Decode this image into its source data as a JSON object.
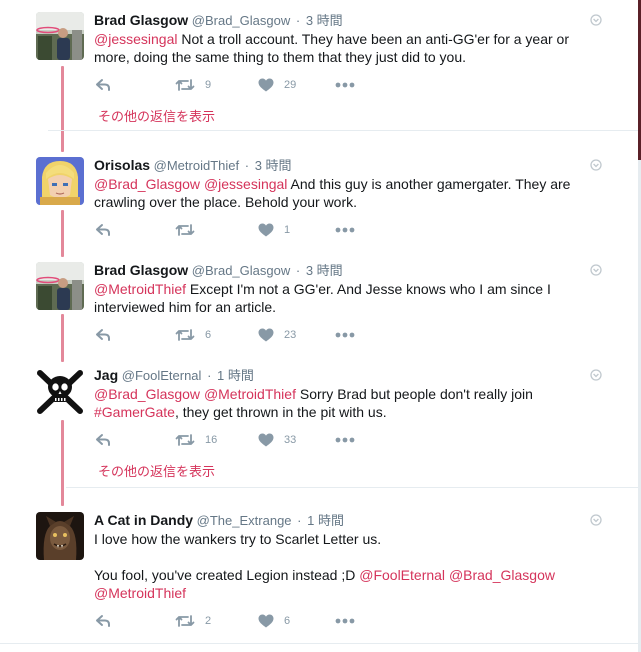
{
  "tweets": [
    {
      "name": "Brad Glasgow",
      "handle": "@Brad_Glasgow",
      "time": "3 時間",
      "body_line1": [
        {
          "t": "@jessesingal",
          "link": true
        },
        {
          "t": " Not a troll account. They have been an anti-GG'er for a year or",
          "link": false
        }
      ],
      "body_line2": [
        {
          "t": "more, doing the same thing to them that they just did to you.",
          "link": false
        }
      ],
      "retweets": "9",
      "likes": "29",
      "more_replies": "その他の返信を表示"
    },
    {
      "name": "Orisolas",
      "handle": "@MetroidThief",
      "time": "3 時間",
      "body_line1": [
        {
          "t": "@Brad_Glasgow",
          "link": true
        },
        {
          "t": " ",
          "link": false
        },
        {
          "t": "@jessesingal",
          "link": true
        },
        {
          "t": " And this guy is another gamergater. They are",
          "link": false
        }
      ],
      "body_line2": [
        {
          "t": "crawling over the place. Behold your work.",
          "link": false
        }
      ],
      "retweets": "",
      "likes": "1"
    },
    {
      "name": "Brad Glasgow",
      "handle": "@Brad_Glasgow",
      "time": "3 時間",
      "body_line1": [
        {
          "t": "@MetroidThief",
          "link": true
        },
        {
          "t": " Except I'm not a GG'er. And Jesse knows who I am since I",
          "link": false
        }
      ],
      "body_line2": [
        {
          "t": "interviewed him for an article.",
          "link": false
        }
      ],
      "retweets": "6",
      "likes": "23"
    },
    {
      "name": "Jag",
      "handle": "@FoolEternal",
      "time": "1 時間",
      "body_line1": [
        {
          "t": "@Brad_Glasgow",
          "link": true
        },
        {
          "t": " ",
          "link": false
        },
        {
          "t": "@MetroidThief",
          "link": true
        },
        {
          "t": " Sorry Brad but people don't really join",
          "link": false
        }
      ],
      "body_line2": [
        {
          "t": "#GamerGate",
          "link": true
        },
        {
          "t": ", they get thrown in the pit with us.",
          "link": false
        }
      ],
      "retweets": "16",
      "likes": "33",
      "more_replies": "その他の返信を表示"
    },
    {
      "name": "A Cat in Dandy",
      "handle": "@The_Extrange",
      "time": "1 時間",
      "body_line1": [
        {
          "t": "I love how the wankers try to Scarlet Letter us.",
          "link": false
        }
      ],
      "body_line2": [
        {
          "t": "You fool, you've created Legion instead ;D ",
          "link": false
        },
        {
          "t": "@FoolEternal",
          "link": true
        },
        {
          "t": " ",
          "link": false
        },
        {
          "t": "@Brad_Glasgow",
          "link": true
        }
      ],
      "body_line3": [
        {
          "t": "@MetroidThief",
          "link": true
        }
      ],
      "retweets": "2",
      "likes": "6"
    }
  ],
  "colors": {
    "accent": "#d5345b",
    "thread_line": "#e3889a",
    "muted": "#8899a6"
  },
  "icons": [
    "reply-icon",
    "retweet-icon",
    "like-icon",
    "more-icon",
    "chevron-down-icon"
  ]
}
